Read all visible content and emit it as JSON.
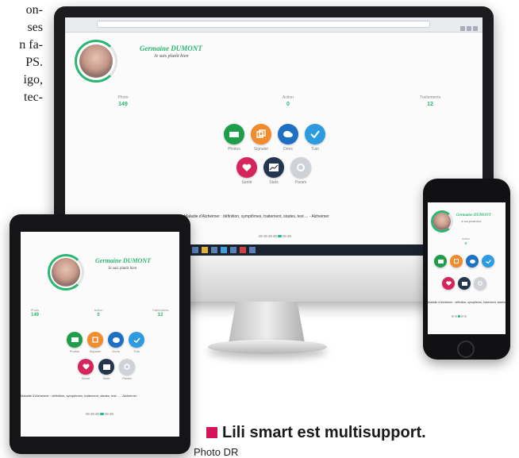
{
  "article_text": {
    "lines": [
      "on-",
      "ses",
      "n fa-",
      "PS.",
      "igo,",
      "tec-"
    ]
  },
  "app": {
    "name": "Germaine DUMONT",
    "subtitle": "Je suis plutôt bien",
    "stats": [
      {
        "label": "Photo",
        "value": "149"
      },
      {
        "label": "Action",
        "value": "0"
      },
      {
        "label": "Traitements",
        "value": "12"
      }
    ],
    "buttons_row1": [
      {
        "label": "Photos",
        "icon": "photo-icon",
        "color": "#1e9e4a"
      },
      {
        "label": "Signaler",
        "icon": "signal-icon",
        "color": "#f08c2b"
      },
      {
        "label": "Dons",
        "icon": "chat-icon",
        "color": "#1f6fc5"
      },
      {
        "label": "Tuto",
        "icon": "check-icon",
        "color": "#2d9be0"
      }
    ],
    "buttons_row2": [
      {
        "label": "Santé",
        "icon": "heart-icon",
        "color": "#d6245c"
      },
      {
        "label": "Stats",
        "icon": "chart-icon",
        "color": "#24364f"
      },
      {
        "label": "Param",
        "icon": "gear-icon",
        "color": "#cfd3d8"
      }
    ],
    "ticker": "Maladie d'Alzheimer : définition, symptômes, traitement, stades, test ... - Alzheimer"
  },
  "caption": {
    "text": "Lili smart est multisupport.",
    "credit": "Photo DR"
  },
  "colors": {
    "accent": "#2bb673",
    "caption_marker": "#d4145a"
  }
}
